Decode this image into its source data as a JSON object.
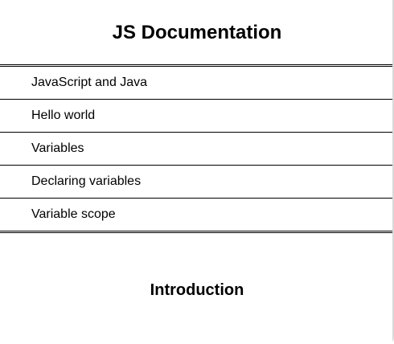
{
  "nav": {
    "title": "JS Documentation",
    "items": [
      {
        "label": "JavaScript and Java"
      },
      {
        "label": "Hello world"
      },
      {
        "label": "Variables"
      },
      {
        "label": "Declaring variables"
      },
      {
        "label": "Variable scope"
      }
    ]
  },
  "main": {
    "section_title": "Introduction"
  }
}
